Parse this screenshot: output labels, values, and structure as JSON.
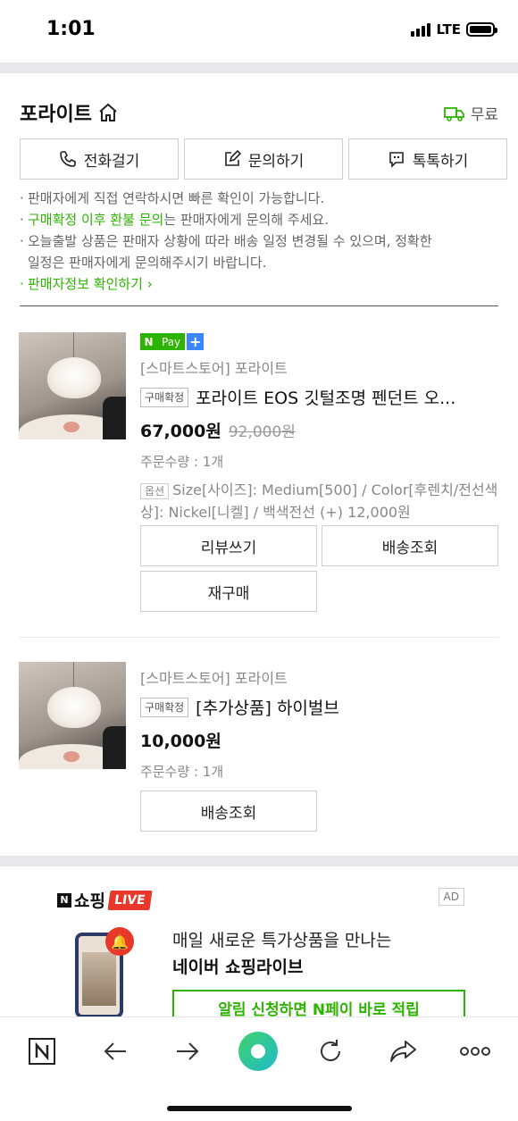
{
  "status_bar": {
    "time": "1:01",
    "network": "LTE"
  },
  "store": {
    "name": "포라이트",
    "shipping": "무료",
    "buttons": {
      "call": "전화걸기",
      "inquiry": "문의하기",
      "talktalk": "톡톡하기"
    }
  },
  "notes": {
    "line1": "판매자에게 직접 연락하시면 빠른 확인이 가능합니다.",
    "line2_highlight": "구매확정 이후 환불 문의",
    "line2_rest": "는 판매자에게 문의해 주세요.",
    "line3a": "오늘출발 상품은 판매자 상황에 따라 배송 일정 변경될 수 있으며, 정확한",
    "line3b": "일정은 판매자에게 문의해주시기 바랍니다.",
    "seller_info_link": "판매자정보 확인하기"
  },
  "orders": [
    {
      "npay_label": "Pay",
      "seller": "[스마트스토어] 포라이트",
      "status_badge": "구매확정",
      "title": "포라이트 EOS 깃털조명 펜던트 오...",
      "price": "67,000원",
      "original_price": "92,000원",
      "quantity": "주문수량 : 1개",
      "option_badge": "옵션",
      "option_text": "Size[사이즈]: Medium[500] / Color[후렌치/전선색상]: Nickel[니켈] / 백색전선 (+) 12,000원",
      "buttons": {
        "review": "리뷰쓰기",
        "tracking": "배송조회",
        "reorder": "재구매"
      }
    },
    {
      "seller": "[스마트스토어] 포라이트",
      "status_badge": "구매확정",
      "title": "[추가상품] 하이벌브",
      "price": "10,000원",
      "quantity": "주문수량 : 1개",
      "buttons": {
        "tracking": "배송조회"
      }
    }
  ],
  "ad": {
    "logo_n": "N",
    "logo_shopping": "쇼핑",
    "logo_live": "LIVE",
    "tag": "AD",
    "line1": "매일 새로운 특가상품을 만나는",
    "line2": "네이버 쇼핑라이브",
    "cta": "알림 신청하면 N페이 바로 적립"
  },
  "toolbar": {
    "icons": [
      "naver-home-icon",
      "back-arrow-icon",
      "forward-arrow-icon",
      "green-dot-icon",
      "reload-icon",
      "share-icon",
      "more-icon"
    ],
    "accent": "#2db400"
  }
}
